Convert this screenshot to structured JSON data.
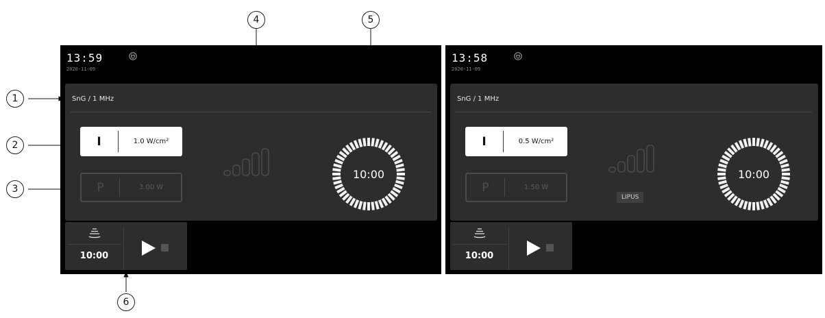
{
  "callouts": [
    "1",
    "2",
    "3",
    "4",
    "5",
    "6"
  ],
  "screens": [
    {
      "time": "13:59",
      "date": "2020-11-09",
      "mode_label": "SnG / 1 MHz",
      "intensity": {
        "letter": "I",
        "value": "1.0 W/cm²"
      },
      "power": {
        "letter": "P",
        "value": "3.00 W"
      },
      "signal_badge": "",
      "timer": "10:00",
      "bottom_time": "10:00"
    },
    {
      "time": "13:58",
      "date": "2020-11-09",
      "mode_label": "SnG / 1 MHz",
      "intensity": {
        "letter": "I",
        "value": "0.5 W/cm²"
      },
      "power": {
        "letter": "P",
        "value": "1.50 W"
      },
      "signal_badge": "LIPUS",
      "timer": "10:00",
      "bottom_time": "10:00"
    }
  ],
  "colors": {
    "screen_bg": "#000000",
    "panel_bg": "#2d2d2d",
    "accent": "#ffffff",
    "inactive": "#4b4b4b"
  },
  "icons": {
    "power": "power-plug-icon",
    "transducer": "ultrasound-transducer-icon",
    "play": "play-icon",
    "stop": "stop-icon"
  }
}
